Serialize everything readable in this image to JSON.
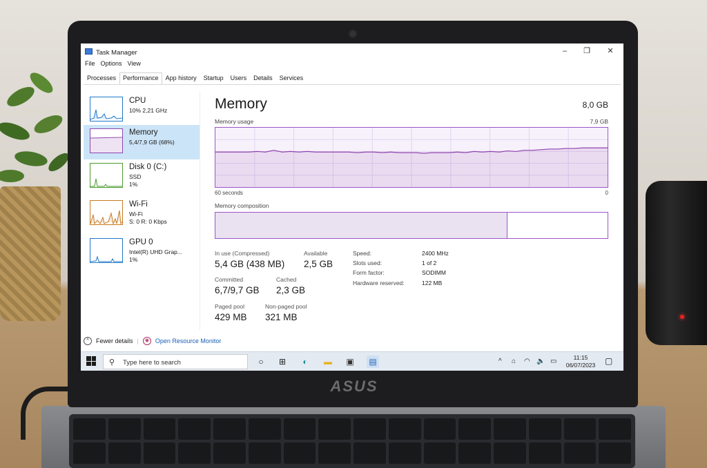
{
  "window": {
    "title": "Task Manager",
    "controls": [
      "–",
      "❐",
      "✕"
    ]
  },
  "menu": [
    "File",
    "Options",
    "View"
  ],
  "tabs": [
    "Processes",
    "Performance",
    "App history",
    "Startup",
    "Users",
    "Details",
    "Services"
  ],
  "active_tab": "Performance",
  "sidebar": [
    {
      "title": "CPU",
      "sub1": "10% 2,21 GHz",
      "sub2": "",
      "color": "#1f77c8",
      "selected": false
    },
    {
      "title": "Memory",
      "sub1": "5,4/7,9 GB (68%)",
      "sub2": "",
      "color": "#8e44ad",
      "selected": true
    },
    {
      "title": "Disk 0 (C:)",
      "sub1": "SSD",
      "sub2": "1%",
      "color": "#4d9a2e",
      "selected": false
    },
    {
      "title": "Wi-Fi",
      "sub1": "Wi-Fi",
      "sub2": "S: 0 R: 0 Kbps",
      "color": "#c87a1f",
      "selected": false
    },
    {
      "title": "GPU 0",
      "sub1": "Intel(R) UHD Grap...",
      "sub2": "1%",
      "color": "#1f77c8",
      "selected": false
    }
  ],
  "memory": {
    "title": "Memory",
    "total": "8,0 GB",
    "usage_label": "Memory usage",
    "usage_max": "7,9 GB",
    "axis_left": "60 seconds",
    "axis_right": "0",
    "composition_label": "Memory composition",
    "composition_in_use_fraction": 0.745,
    "usage_history": [
      0.59,
      0.59,
      0.59,
      0.59,
      0.59,
      0.6,
      0.59,
      0.62,
      0.59,
      0.6,
      0.59,
      0.6,
      0.59,
      0.59,
      0.59,
      0.59,
      0.59,
      0.58,
      0.59,
      0.59,
      0.58,
      0.59,
      0.58,
      0.58,
      0.58,
      0.57,
      0.58,
      0.58,
      0.58,
      0.59,
      0.58,
      0.6,
      0.59,
      0.6,
      0.59,
      0.61,
      0.6,
      0.62,
      0.62,
      0.63,
      0.64,
      0.64,
      0.65,
      0.65,
      0.66,
      0.66,
      0.66,
      0.66
    ]
  },
  "stats": {
    "in_use_label": "In use (Compressed)",
    "in_use": "5,4 GB (438 MB)",
    "available_label": "Available",
    "available": "2,5 GB",
    "committed_label": "Committed",
    "committed": "6,7/9,7 GB",
    "cached_label": "Cached",
    "cached": "2,3 GB",
    "paged_label": "Paged pool",
    "paged": "429 MB",
    "nonpaged_label": "Non-paged pool",
    "nonpaged": "321 MB"
  },
  "info": [
    {
      "k": "Speed:",
      "v": "2400 MHz"
    },
    {
      "k": "Slots used:",
      "v": "1 of 2"
    },
    {
      "k": "Form factor:",
      "v": "SODIMM"
    },
    {
      "k": "Hardware reserved:",
      "v": "122 MB"
    }
  ],
  "footer": {
    "fewer_details": "Fewer details",
    "open_monitor": "Open Resource Monitor"
  },
  "taskbar": {
    "search_placeholder": "Type here to search",
    "time": "11:15",
    "date": "06/07/2023",
    "icons": [
      "task-view-icon",
      "widgets-icon",
      "edge-icon",
      "file-explorer-icon",
      "store-icon",
      "task-manager-icon"
    ]
  },
  "laptop": {
    "brand": "ASUS"
  }
}
